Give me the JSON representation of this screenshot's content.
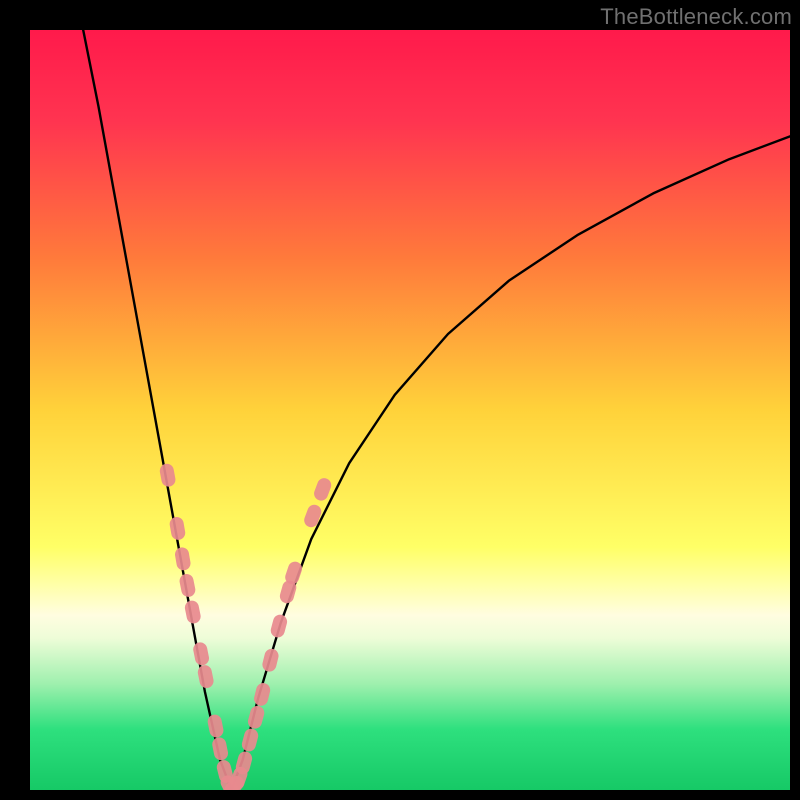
{
  "watermark": "TheBottleneck.com",
  "chart_data": {
    "type": "line",
    "title": "",
    "xlabel": "",
    "ylabel": "",
    "xlim": [
      0,
      100
    ],
    "ylim": [
      0,
      100
    ],
    "gradient_stops": [
      {
        "pct": 0.0,
        "color": "#ff1a4b"
      },
      {
        "pct": 0.12,
        "color": "#ff3450"
      },
      {
        "pct": 0.3,
        "color": "#ff7a3b"
      },
      {
        "pct": 0.5,
        "color": "#ffd23a"
      },
      {
        "pct": 0.68,
        "color": "#ffff66"
      },
      {
        "pct": 0.73,
        "color": "#ffffa8"
      },
      {
        "pct": 0.77,
        "color": "#fffde0"
      },
      {
        "pct": 0.8,
        "color": "#eefdd8"
      },
      {
        "pct": 0.86,
        "color": "#9ff0ae"
      },
      {
        "pct": 0.92,
        "color": "#2ee07e"
      },
      {
        "pct": 1.0,
        "color": "#16c966"
      }
    ],
    "series": [
      {
        "name": "left-arm",
        "x": [
          7,
          9,
          11,
          13,
          15,
          17,
          19,
          21,
          23,
          25,
          26.5
        ],
        "values": [
          100,
          90,
          79,
          68,
          57,
          46,
          35,
          24,
          13,
          4,
          0
        ]
      },
      {
        "name": "right-arm",
        "x": [
          26.5,
          28,
          30,
          33,
          37,
          42,
          48,
          55,
          63,
          72,
          82,
          92,
          100
        ],
        "values": [
          0,
          4,
          12,
          22,
          33,
          43,
          52,
          60,
          67,
          73,
          78.5,
          83,
          86
        ]
      }
    ],
    "markers": {
      "name": "pink-segments",
      "color": "#e98a8f",
      "radius_px": 7,
      "points": [
        {
          "x": 18.0,
          "y": 42.0
        },
        {
          "x": 19.3,
          "y": 35.0
        },
        {
          "x": 20.0,
          "y": 31.0
        },
        {
          "x": 20.6,
          "y": 27.5
        },
        {
          "x": 21.3,
          "y": 24.0
        },
        {
          "x": 22.4,
          "y": 18.5
        },
        {
          "x": 23.0,
          "y": 15.5
        },
        {
          "x": 24.3,
          "y": 9.0
        },
        {
          "x": 24.9,
          "y": 6.0
        },
        {
          "x": 25.5,
          "y": 3.0
        },
        {
          "x": 26.0,
          "y": 1.0
        },
        {
          "x": 26.5,
          "y": 0.0
        },
        {
          "x": 27.3,
          "y": 1.0
        },
        {
          "x": 28.0,
          "y": 3.0
        },
        {
          "x": 28.8,
          "y": 6.0
        },
        {
          "x": 29.6,
          "y": 9.0
        },
        {
          "x": 30.4,
          "y": 12.0
        },
        {
          "x": 31.5,
          "y": 16.5
        },
        {
          "x": 32.6,
          "y": 21.0
        },
        {
          "x": 33.8,
          "y": 25.5
        },
        {
          "x": 34.5,
          "y": 28.0
        },
        {
          "x": 37.0,
          "y": 35.5
        },
        {
          "x": 38.3,
          "y": 39.0
        }
      ]
    }
  }
}
